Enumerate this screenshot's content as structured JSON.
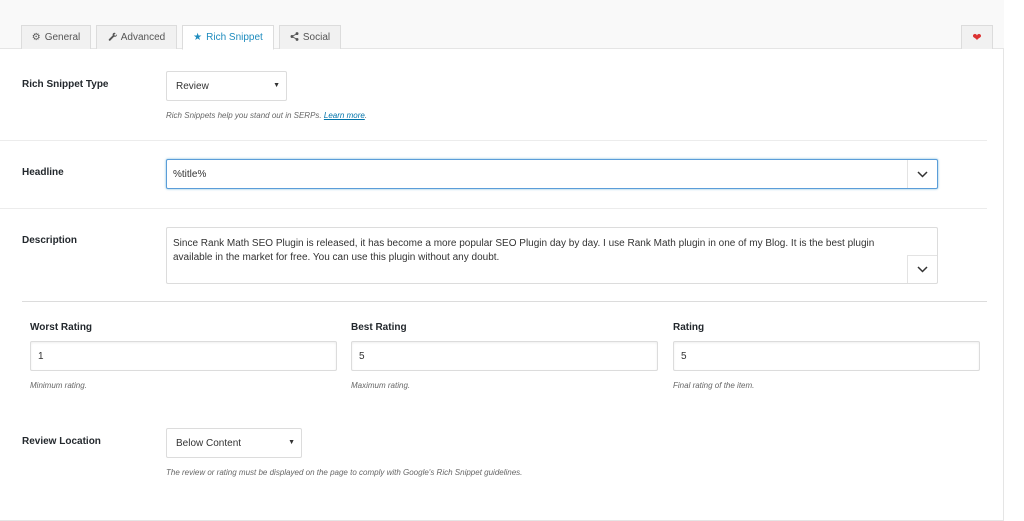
{
  "tabs": [
    {
      "label": "General",
      "icon": "gear-icon"
    },
    {
      "label": "Advanced",
      "icon": "wrench-icon"
    },
    {
      "label": "Rich Snippet",
      "icon": "star-icon"
    },
    {
      "label": "Social",
      "icon": "share-icon"
    }
  ],
  "active_tab": "Rich Snippet",
  "heart_icon": "heart-icon",
  "fields": {
    "snippet_type": {
      "label": "Rich Snippet Type",
      "value": "Review",
      "hint_text": "Rich Snippets help you stand out in SERPs.",
      "hint_link": "Learn more"
    },
    "headline": {
      "label": "Headline",
      "value": "%title%"
    },
    "description": {
      "label": "Description",
      "value": "Since Rank Math SEO Plugin is released, it has become a more popular SEO Plugin day by day. I use Rank Math plugin in one of my Blog. It is the best plugin available in the market for free. You can use this plugin without any doubt."
    },
    "worst_rating": {
      "label": "Worst Rating",
      "value": "1",
      "hint": "Minimum rating."
    },
    "best_rating": {
      "label": "Best Rating",
      "value": "5",
      "hint": "Maximum rating."
    },
    "rating": {
      "label": "Rating",
      "value": "5",
      "hint": "Final rating of the item."
    },
    "review_location": {
      "label": "Review Location",
      "value": "Below Content",
      "hint": "The review or rating must be displayed on the page to comply with Google's Rich Snippet guidelines."
    }
  },
  "colors": {
    "accent": "#1e8cbe",
    "heart": "#dc3232"
  }
}
